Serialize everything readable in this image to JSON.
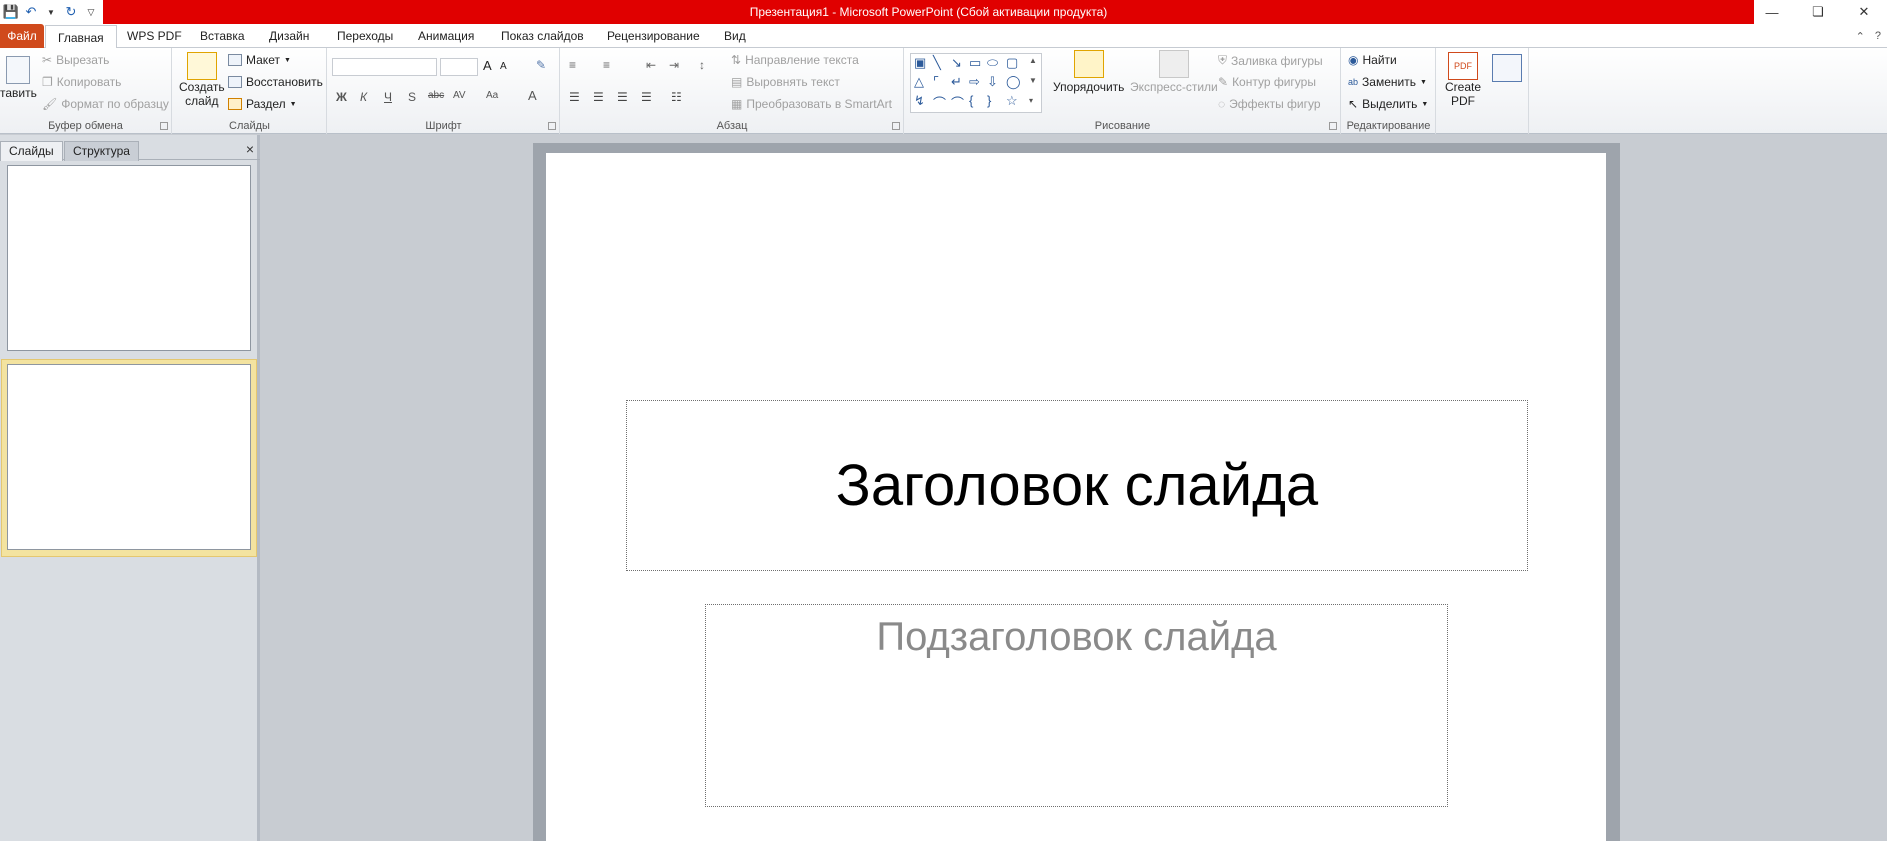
{
  "window": {
    "title": "Презентация1 - Microsoft PowerPoint (Сбой активации продукта)",
    "controls": [
      "minimize-icon",
      "restore-icon",
      "close-icon"
    ]
  },
  "qat": {
    "icons": [
      "save-icon",
      "undo-icon",
      "redo-icon",
      "customize-qat-icon"
    ]
  },
  "tabs": {
    "file": "Файл",
    "items": [
      "Главная",
      "WPS PDF",
      "Вставка",
      "Дизайн",
      "Переходы",
      "Анимация",
      "Показ слайдов",
      "Рецензирование",
      "Вид"
    ]
  },
  "ribbon": {
    "clipboard": {
      "label": "Буфер обмена",
      "paste": "тавить",
      "cut": "Вырезать",
      "copy": "Копировать",
      "format_painter": "Формат по образцу"
    },
    "slides": {
      "label": "Слайды",
      "new_slide_l1": "Создать",
      "new_slide_l2": "слайд",
      "layout": "Макет",
      "reset": "Восстановить",
      "section": "Раздел"
    },
    "font": {
      "label": "Шрифт",
      "bold": "Ж",
      "italic": "К",
      "underline": "Ч",
      "shadow": "S",
      "strike": "abc",
      "spacing": "AV",
      "case": "Aa",
      "color": "A",
      "grow": "A",
      "shrink": "A"
    },
    "paragraph": {
      "label": "Абзац",
      "text_direction": "Направление текста",
      "align_text": "Выровнять текст",
      "smartart": "Преобразовать в SmartArt"
    },
    "drawing": {
      "label": "Рисование",
      "arrange": "Упорядочить",
      "quick_styles": "Экспресс-стили",
      "shape_fill": "Заливка фигуры",
      "shape_outline": "Контур фигуры",
      "shape_effects": "Эффекты фигур"
    },
    "editing": {
      "label": "Редактирование",
      "find": "Найти",
      "replace": "Заменить",
      "select": "Выделить"
    },
    "pdf": {
      "create_l1": "Create",
      "create_l2": "PDF"
    }
  },
  "leftpane": {
    "tab_slides": "Слайды",
    "tab_outline": "Структура",
    "close": "×"
  },
  "slide": {
    "title": "Заголовок слайда",
    "subtitle": "Подзаголовок слайда"
  }
}
